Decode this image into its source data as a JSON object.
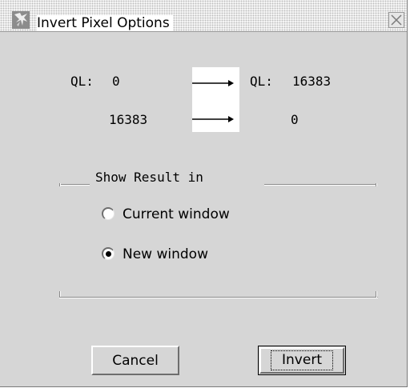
{
  "window": {
    "title": "Invert Pixel Options",
    "icon": "app-window-icon",
    "close_icon": "close-icon"
  },
  "mapping": {
    "rows": [
      {
        "from_label": "QL:",
        "from_value": "0",
        "to_label": "QL:",
        "to_value": "16383"
      },
      {
        "from_label": "",
        "from_value": "16383",
        "to_label": "",
        "to_value": "0"
      }
    ],
    "arrow_icon": "right-arrow-icon"
  },
  "result_group": {
    "label": "Show Result in",
    "options": [
      {
        "label": "Current window",
        "selected": false
      },
      {
        "label": "New window",
        "selected": true
      }
    ]
  },
  "buttons": {
    "cancel": "Cancel",
    "invert": "Invert"
  },
  "colors": {
    "dialog_bg": "#d6d6d6",
    "text": "#000000"
  }
}
